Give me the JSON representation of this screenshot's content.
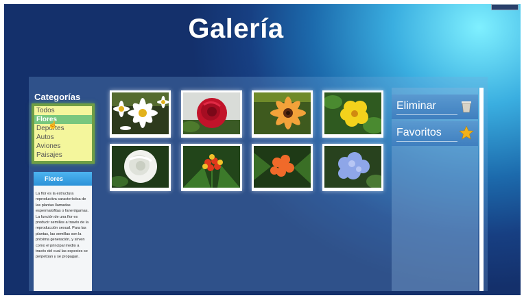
{
  "header": {
    "title": "Galería"
  },
  "categories": {
    "title": "Categorías",
    "items": [
      "Todos",
      "Flores",
      "Deportes",
      "Autos",
      "Aviones",
      "Paisajes"
    ],
    "selected": "Flores"
  },
  "info": {
    "title": "Flores",
    "text": "La flor es la estructura reproductiva característica de las plantas llamadas espermatofitas o fanerógamas. La función de una flor es producir semillas a través de la reproducción sexual. Para las plantas, las semillas son la próxima generación, y sirven como el principal medio a través del cual las especies se perpetúan y se propagan."
  },
  "gallery": {
    "images": [
      {
        "name": "daisies",
        "icon": "white-daisy-flowers"
      },
      {
        "name": "red-rose",
        "icon": "red-rose-flower"
      },
      {
        "name": "orange-gerbera",
        "icon": "orange-gerbera-flower"
      },
      {
        "name": "yellow-flower",
        "icon": "yellow-flower"
      },
      {
        "name": "white-rose",
        "icon": "white-rose-flower"
      },
      {
        "name": "milkweed",
        "icon": "orange-red-milkweed-flower"
      },
      {
        "name": "ixora",
        "icon": "orange-ixora-flower"
      },
      {
        "name": "hydrangea",
        "icon": "blue-hydrangea-flower"
      }
    ]
  },
  "actions": {
    "delete_label": "Eliminar",
    "favorites_label": "Favoritos",
    "delete_icon": "trash-icon",
    "favorites_icon": "star-icon"
  },
  "colors": {
    "accent": "#78c77e",
    "category_bg": "#f4f69c",
    "info_header": "#2c92d8",
    "star": "#f2b21b"
  }
}
